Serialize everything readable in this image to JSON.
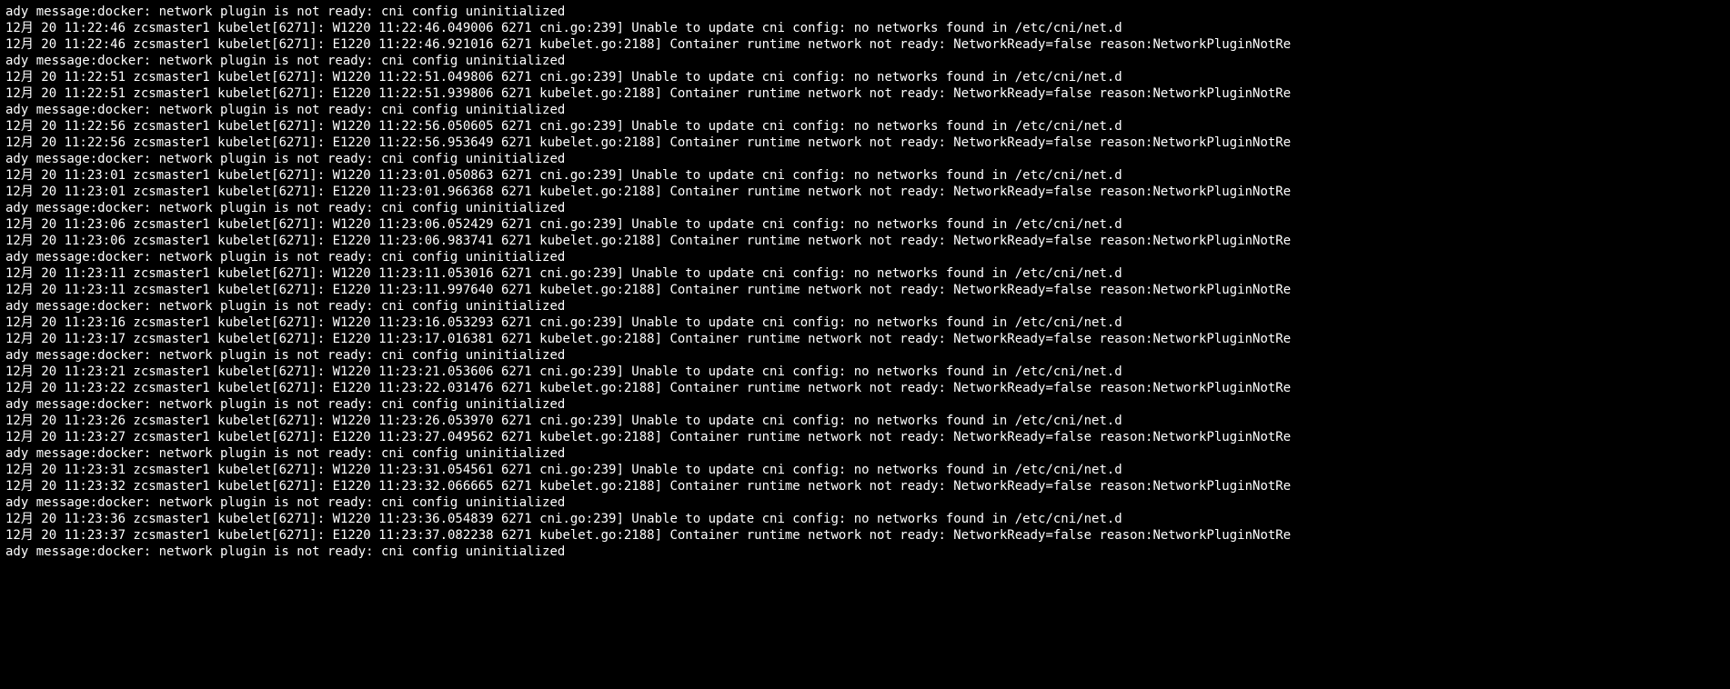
{
  "terminal": {
    "host": "zcsmaster1",
    "process": "kubelet",
    "pid": "6271",
    "month_day": "12月 20",
    "strings": {
      "wrap_prefix": "ady message:docker: network plugin is not ready: cni config uninitialized",
      "cni_msg": "cni.go:239] Unable to update cni config: no networks found in /etc/cni/net.d",
      "kubelet_msg": "kubelet.go:2188] Container runtime network not ready: NetworkReady=false reason:NetworkPluginNotRe"
    },
    "events": [
      {
        "ts": "11:22:46",
        "wlog": "W1220 11:22:46.049006",
        "elog_ts": "11:22:46",
        "elog": "E1220 11:22:46.921016"
      },
      {
        "ts": "11:22:51",
        "wlog": "W1220 11:22:51.049806",
        "elog_ts": "11:22:51",
        "elog": "E1220 11:22:51.939806"
      },
      {
        "ts": "11:22:56",
        "wlog": "W1220 11:22:56.050605",
        "elog_ts": "11:22:56",
        "elog": "E1220 11:22:56.953649"
      },
      {
        "ts": "11:23:01",
        "wlog": "W1220 11:23:01.050863",
        "elog_ts": "11:23:01",
        "elog": "E1220 11:23:01.966368"
      },
      {
        "ts": "11:23:06",
        "wlog": "W1220 11:23:06.052429",
        "elog_ts": "11:23:06",
        "elog": "E1220 11:23:06.983741"
      },
      {
        "ts": "11:23:11",
        "wlog": "W1220 11:23:11.053016",
        "elog_ts": "11:23:11",
        "elog": "E1220 11:23:11.997640"
      },
      {
        "ts": "11:23:16",
        "wlog": "W1220 11:23:16.053293",
        "elog_ts": "11:23:17",
        "elog": "E1220 11:23:17.016381"
      },
      {
        "ts": "11:23:21",
        "wlog": "W1220 11:23:21.053606",
        "elog_ts": "11:23:22",
        "elog": "E1220 11:23:22.031476"
      },
      {
        "ts": "11:23:26",
        "wlog": "W1220 11:23:26.053970",
        "elog_ts": "11:23:27",
        "elog": "E1220 11:23:27.049562"
      },
      {
        "ts": "11:23:31",
        "wlog": "W1220 11:23:31.054561",
        "elog_ts": "11:23:32",
        "elog": "E1220 11:23:32.066665"
      },
      {
        "ts": "11:23:36",
        "wlog": "W1220 11:23:36.054839",
        "elog_ts": "11:23:37",
        "elog": "E1220 11:23:37.082238"
      }
    ]
  }
}
